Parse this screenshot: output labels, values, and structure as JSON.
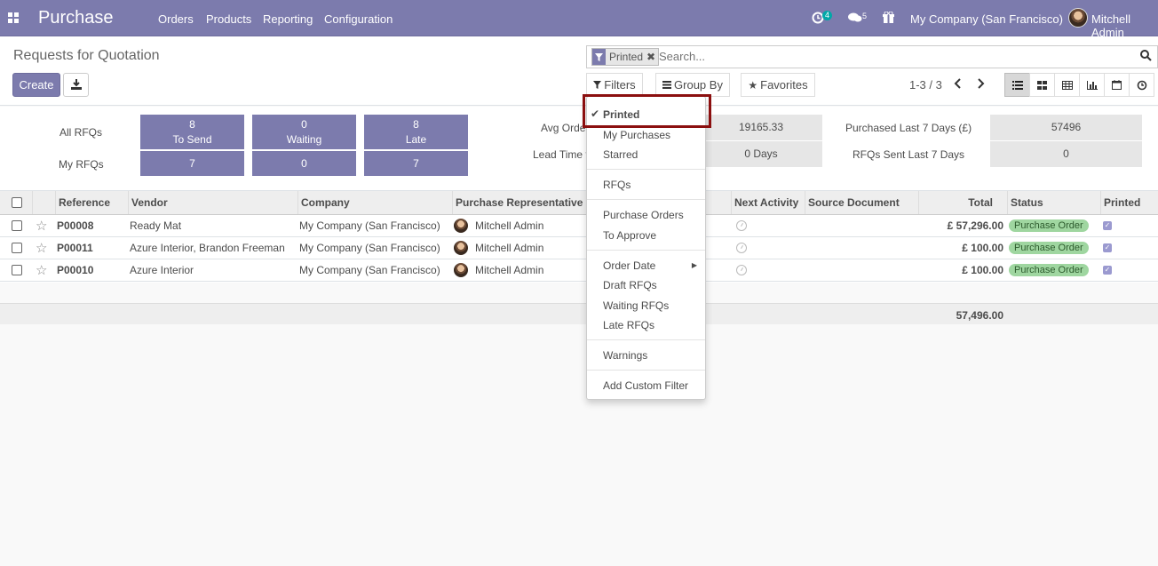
{
  "navbar": {
    "brand": "Purchase",
    "menu": [
      "Orders",
      "Products",
      "Reporting",
      "Configuration"
    ],
    "activity_count": "4",
    "message_count": "5",
    "company": "My Company (San Francisco)",
    "user": "Mitchell Admin"
  },
  "control_panel": {
    "breadcrumb": "Requests for Quotation",
    "create_label": "Create",
    "search": {
      "facet_label": "Printed",
      "placeholder": "Search..."
    },
    "filters_label": "Filters",
    "groupby_label": "Group By",
    "favorites_label": "Favorites",
    "pager": "1-3 / 3"
  },
  "dashboard": {
    "all_rfqs_label": "All RFQs",
    "my_rfqs_label": "My RFQs",
    "tiles": [
      {
        "num": "8",
        "label": "To Send",
        "my": "7"
      },
      {
        "num": "0",
        "label": "Waiting",
        "my": "0"
      },
      {
        "num": "8",
        "label": "Late",
        "my": "7"
      }
    ],
    "avg_order_label": "Avg Order",
    "avg_order_value": "19165.33",
    "lead_time_label": "Lead Time t",
    "lead_time_value": "0  Days",
    "purchased_label": "Purchased Last 7 Days (£)",
    "purchased_value": "57496",
    "rfqs_sent_label": "RFQs Sent Last 7 Days",
    "rfqs_sent_value": "0"
  },
  "table": {
    "headers": {
      "reference": "Reference",
      "vendor": "Vendor",
      "company": "Company",
      "rep": "Purchase Representative",
      "next_activity": "Next Activity",
      "source": "Source Document",
      "total": "Total",
      "status": "Status",
      "printed": "Printed"
    },
    "rows": [
      {
        "ref": "P00008",
        "vendor": "Ready Mat",
        "company": "My Company (San Francisco)",
        "rep": "Mitchell Admin",
        "total": "£ 57,296.00",
        "status": "Purchase Order"
      },
      {
        "ref": "P00011",
        "vendor": "Azure Interior, Brandon Freeman",
        "company": "My Company (San Francisco)",
        "rep": "Mitchell Admin",
        "total": "£ 100.00",
        "status": "Purchase Order"
      },
      {
        "ref": "P00010",
        "vendor": "Azure Interior",
        "company": "My Company (San Francisco)",
        "rep": "Mitchell Admin",
        "total": "£ 100.00",
        "status": "Purchase Order"
      }
    ],
    "sum_total": "57,496.00"
  },
  "filters_dropdown": {
    "items": {
      "printed": "Printed",
      "my_purchases": "My Purchases",
      "starred": "Starred",
      "rfqs": "RFQs",
      "purchase_orders": "Purchase Orders",
      "to_approve": "To Approve",
      "order_date": "Order Date",
      "draft_rfqs": "Draft RFQs",
      "waiting_rfqs": "Waiting RFQs",
      "late_rfqs": "Late RFQs",
      "warnings": "Warnings",
      "add_custom_filter": "Add Custom Filter"
    }
  },
  "colors": {
    "brand": "#7c7bad",
    "status_green": "#9fd6a0",
    "highlight": "#8b0f0f"
  }
}
